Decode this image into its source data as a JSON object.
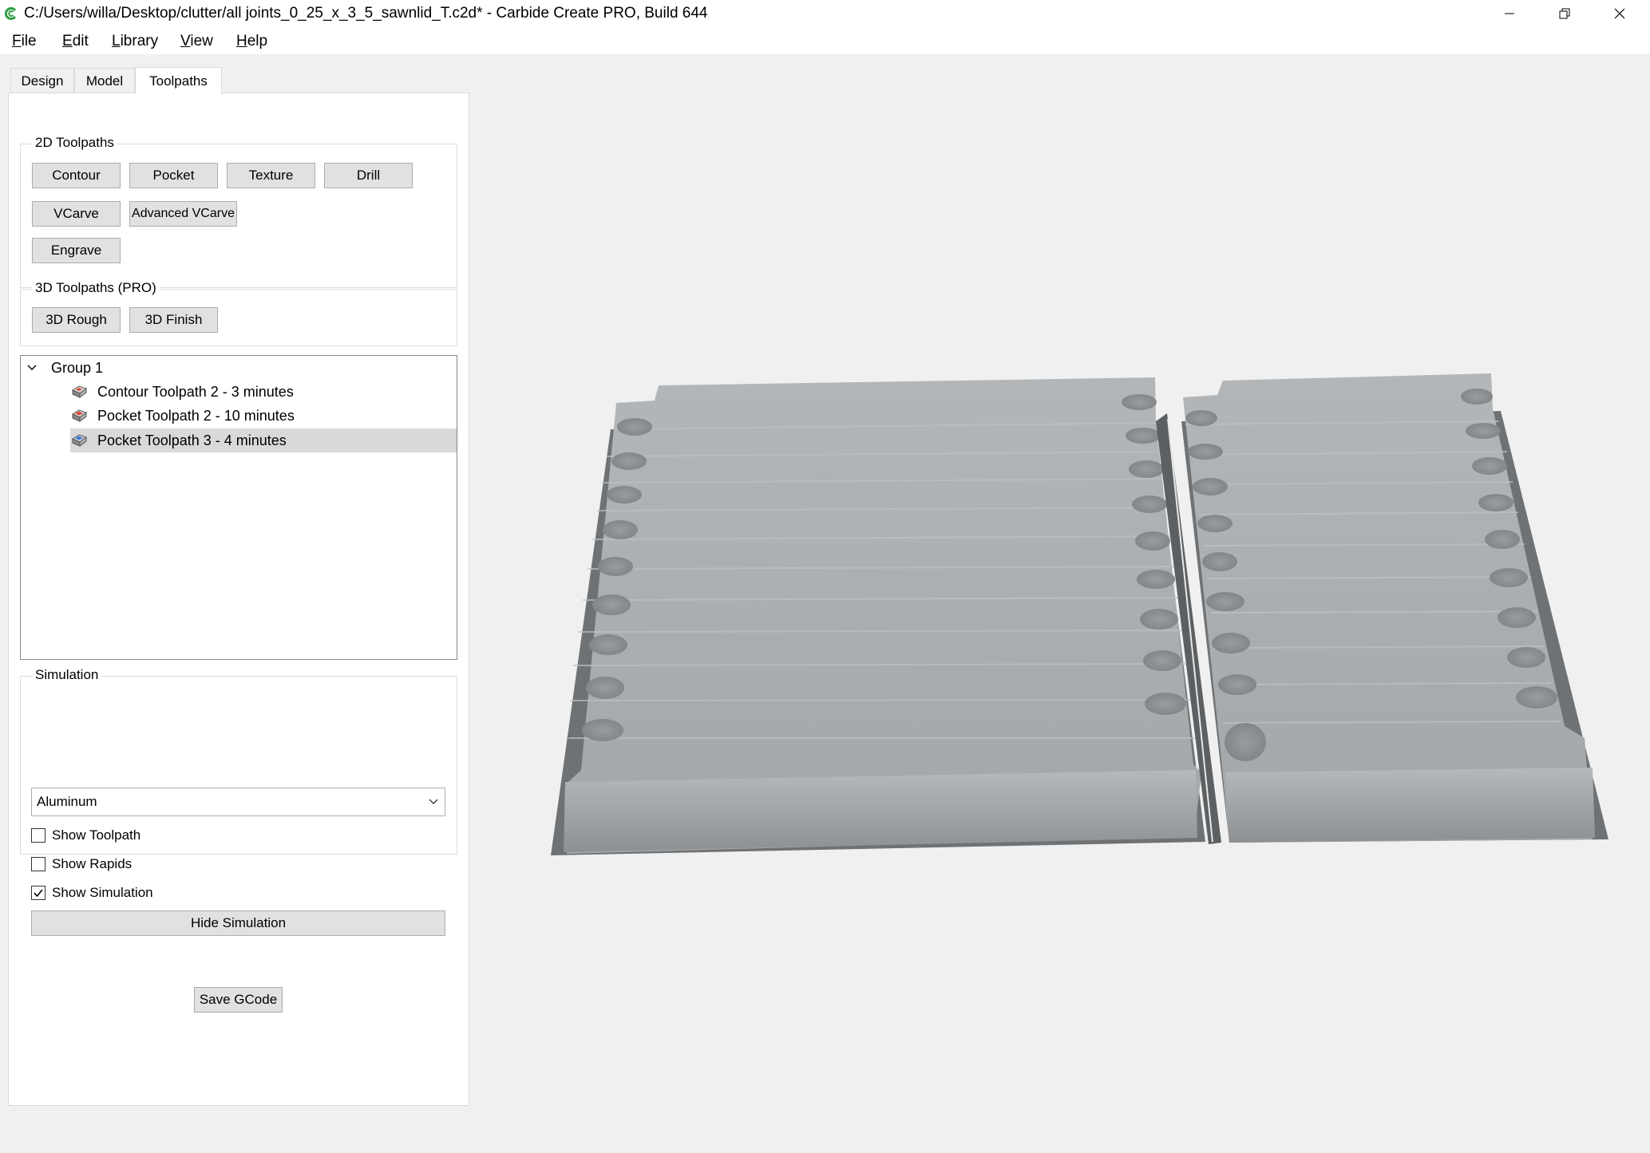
{
  "window": {
    "title": "C:/Users/willa/Desktop/clutter/all joints_0_25_x_3_5_sawnlid_T.c2d* - Carbide Create PRO, Build 644",
    "controls": [
      "minimize-icon",
      "restore-icon",
      "close-icon"
    ]
  },
  "menu": {
    "items": [
      {
        "label_first": "F",
        "label_rest": "ile"
      },
      {
        "label_first": "E",
        "label_rest": "dit"
      },
      {
        "label_first": "L",
        "label_rest": "ibrary"
      },
      {
        "label_first": "V",
        "label_rest": "iew"
      },
      {
        "label_first": "H",
        "label_rest": "elp"
      }
    ]
  },
  "tabs": [
    {
      "label": "Design"
    },
    {
      "label": "Model"
    },
    {
      "label": "Toolpaths",
      "active": true
    }
  ],
  "toolpaths2d": {
    "title": "2D Toolpaths",
    "buttons": [
      "Contour",
      "Pocket",
      "Texture",
      "Drill",
      "VCarve",
      "Advanced VCarve",
      "Engrave"
    ]
  },
  "toolpaths3d": {
    "title": "3D Toolpaths (PRO)",
    "buttons": [
      "3D Rough",
      "3D Finish"
    ]
  },
  "tree": {
    "group_label": "Group 1",
    "items": [
      {
        "label": "Contour Toolpath 2 - 3 minutes"
      },
      {
        "label": "Pocket Toolpath 2 - 10 minutes"
      },
      {
        "label": "Pocket Toolpath 3 - 4 minutes",
        "selected": true
      }
    ]
  },
  "simulation": {
    "title": "Simulation",
    "material": "Aluminum",
    "show_toolpath_label": "Show Toolpath",
    "show_toolpath": false,
    "show_rapids_label": "Show Rapids",
    "show_rapids": false,
    "show_simulation_label": "Show Simulation",
    "show_simulation": true,
    "hide_button": "Hide Simulation"
  },
  "save_gcode": "Save GCode",
  "colors": {
    "accent_green": "#2f9e44",
    "model_gray": "#a9acae",
    "selection": "#d9d9d9"
  }
}
